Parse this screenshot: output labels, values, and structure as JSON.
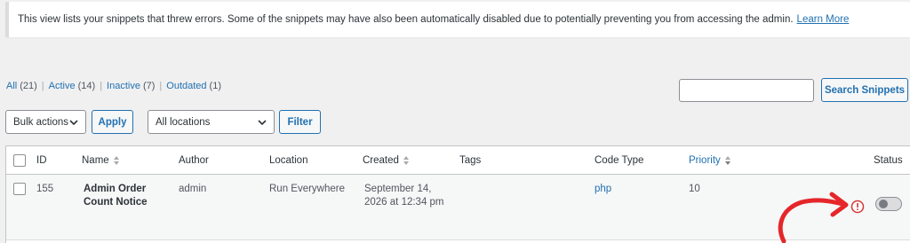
{
  "notice": {
    "text": "This view lists your snippets that threw errors. Some of the snippets may have also been automatically disabled due to potentially preventing you from accessing the admin.",
    "link": "Learn More"
  },
  "filters": [
    {
      "label": "All",
      "count": "(21)"
    },
    {
      "label": "Active",
      "count": "(14)"
    },
    {
      "label": "Inactive",
      "count": "(7)"
    },
    {
      "label": "Outdated",
      "count": "(1)"
    }
  ],
  "search": {
    "value": "",
    "button": "Search Snippets"
  },
  "bulk": {
    "selected": "Bulk actions",
    "apply": "Apply"
  },
  "location": {
    "selected": "All locations",
    "filter": "Filter"
  },
  "table": {
    "headers": {
      "id": "ID",
      "name": "Name",
      "author": "Author",
      "location": "Location",
      "created": "Created",
      "tags": "Tags",
      "code_type": "Code Type",
      "priority": "Priority",
      "status": "Status"
    },
    "rows": [
      {
        "id": "155",
        "name_line1": "Admin Order",
        "name_line2": "Count Notice",
        "author": "admin",
        "location": "Run Everywhere",
        "created_line1": "September 14,",
        "created_line2": "2026 at 12:34 pm",
        "tags": "",
        "code_type": "php",
        "priority": "10",
        "status": "off"
      }
    ]
  },
  "colors": {
    "accent": "#2271b1",
    "error": "#d63638",
    "arrow": "#e5262a"
  },
  "icons": [
    "chevron-down-icon",
    "sort-icon",
    "error-info-icon",
    "pointer-arrow-icon"
  ]
}
